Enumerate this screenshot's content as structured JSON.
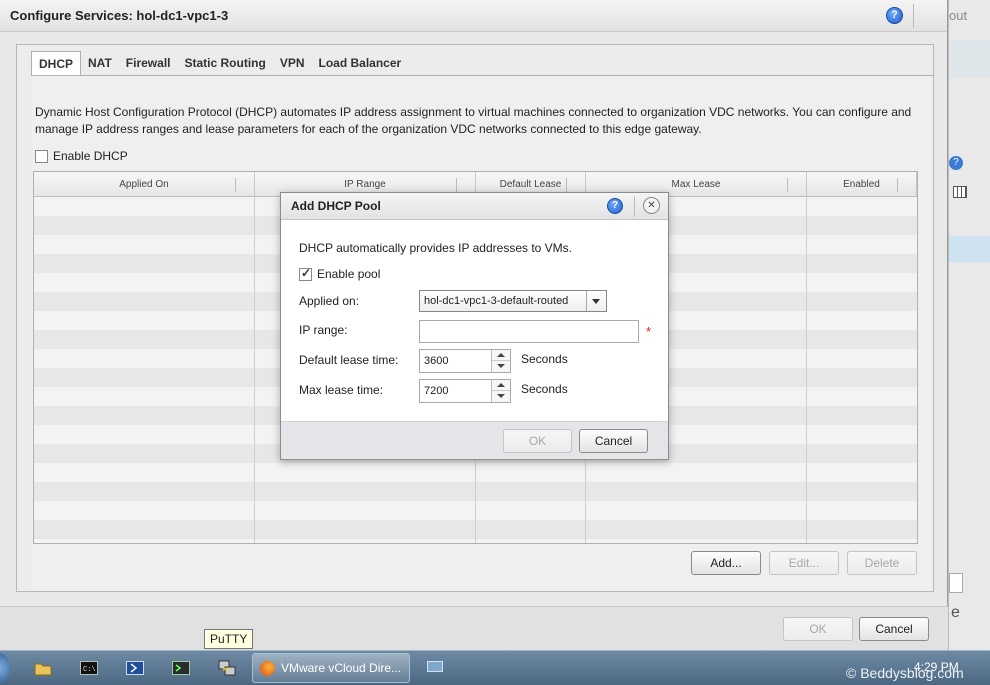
{
  "window": {
    "title": "Configure Services: hol-dc1-vpc1-3"
  },
  "background": {
    "about_fragment": "out"
  },
  "tabs": [
    "DHCP",
    "NAT",
    "Firewall",
    "Static Routing",
    "VPN",
    "Load Balancer"
  ],
  "dhcp": {
    "description": "Dynamic Host Configuration Protocol (DHCP) automates IP address assignment to virtual machines connected to organization VDC networks. You can configure and manage IP address ranges and lease parameters for each of the organization VDC networks connected to this edge gateway.",
    "enable_label": "Enable DHCP",
    "columns": [
      "Applied On",
      "IP Range",
      "Default Lease",
      "Max Lease",
      "Enabled"
    ],
    "add_label": "Add...",
    "edit_label": "Edit...",
    "delete_label": "Delete"
  },
  "footer": {
    "ok_label": "OK",
    "cancel_label": "Cancel"
  },
  "modal": {
    "title": "Add DHCP Pool",
    "description": "DHCP automatically provides IP addresses to VMs.",
    "enable_pool_label": "Enable pool",
    "applied_on_label": "Applied on:",
    "applied_on_value": "hol-dc1-vpc1-3-default-routed",
    "ip_range_label": "IP range:",
    "ip_range_value": "",
    "default_lease_label": "Default lease time:",
    "default_lease_value": "3600",
    "max_lease_label": "Max lease time:",
    "max_lease_value": "7200",
    "unit_label": "Seconds",
    "required_marker": "*",
    "ok_label": "OK",
    "cancel_label": "Cancel"
  },
  "taskbar": {
    "tooltip": "PuTTY",
    "task_label": "VMware vCloud Dire...",
    "time": "4:29 PM",
    "watermark": "© Beddysblog.com"
  },
  "colors": {
    "accent": "#1f5fc8",
    "required": "#dd2222",
    "taskbar": "#4b6782"
  }
}
